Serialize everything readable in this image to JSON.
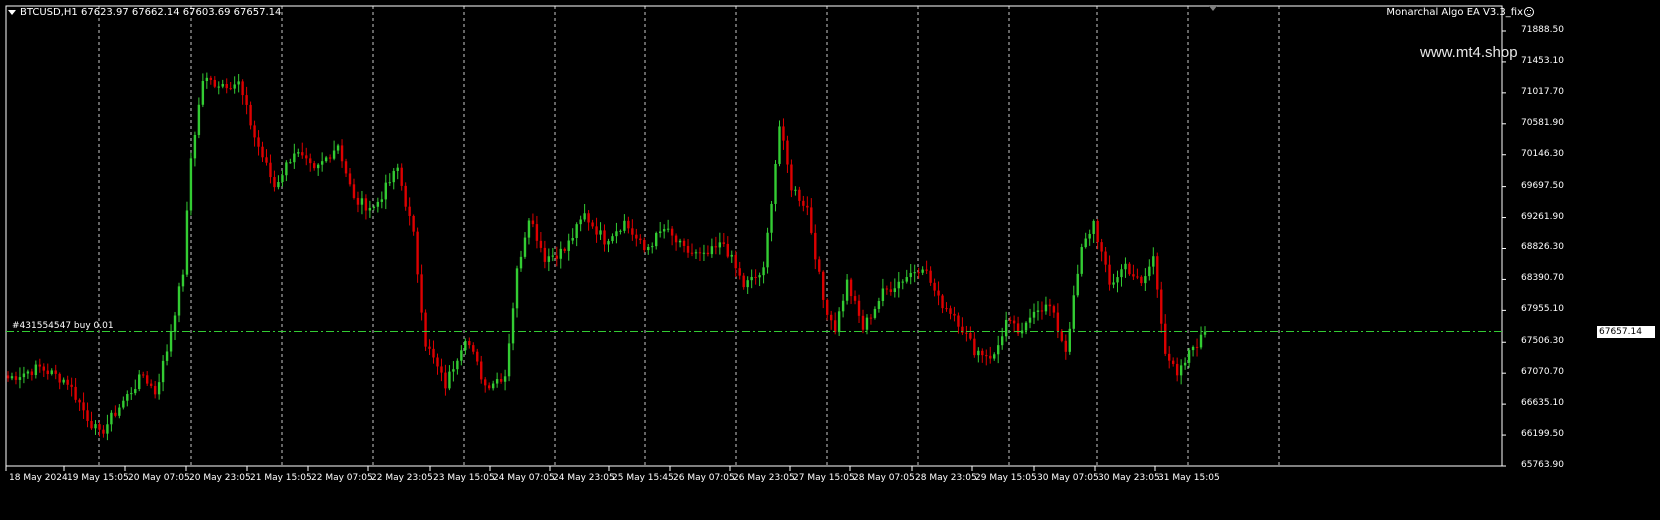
{
  "header": {
    "symbol": "BTCUSD,H1",
    "ohlc": "67623.97 67662.14 67603.69 67657.14",
    "expert_label": "Monarchal Algo EA V3.3_fix",
    "expert_icon": "smiley-icon"
  },
  "watermark": "www.mt4.shop",
  "order_line": {
    "label": "#431554547 buy 0.01",
    "price": 67657.14,
    "color": "#33cc33"
  },
  "current_price_label": "67657.14",
  "colors": {
    "bull": "#33cc33",
    "bear": "#dd0000",
    "grid": "#c8c8c8",
    "background": "#000000",
    "axis": "#ffffff"
  },
  "price_axis": {
    "labels": [
      "71888.50",
      "71453.10",
      "71017.70",
      "70581.90",
      "70146.30",
      "69697.50",
      "69261.90",
      "68826.30",
      "68390.70",
      "67955.10",
      "67506.30",
      "67070.70",
      "66635.10",
      "66199.50",
      "65763.90"
    ],
    "min": 65763.9,
    "max": 71888.5
  },
  "time_axis": {
    "labels": [
      "18 May 2024",
      "19 May 15:05",
      "20 May 07:05",
      "20 May 23:05",
      "21 May 15:05",
      "22 May 07:05",
      "22 May 23:05",
      "23 May 15:05",
      "24 May 07:05",
      "24 May 23:05",
      "25 May 15:45",
      "26 May 07:05",
      "26 May 23:05",
      "27 May 15:05",
      "28 May 07:05",
      "28 May 23:05",
      "29 May 15:05",
      "30 May 07:05",
      "30 May 23:05",
      "31 May 15:05"
    ]
  },
  "chart_data": {
    "type": "candlestick",
    "title": "BTCUSD,H1",
    "xlabel": "",
    "ylabel": "",
    "grid": true,
    "ylim": [
      65763.9,
      71888.5
    ],
    "anchors": [
      [
        0,
        67000
      ],
      [
        8,
        67150
      ],
      [
        15,
        66950
      ],
      [
        20,
        66450
      ],
      [
        23,
        66200
      ],
      [
        28,
        66600
      ],
      [
        34,
        67050
      ],
      [
        37,
        66800
      ],
      [
        40,
        67400
      ],
      [
        44,
        68500
      ],
      [
        46,
        70100
      ],
      [
        49,
        71200
      ],
      [
        53,
        71150
      ],
      [
        58,
        71150
      ],
      [
        62,
        70400
      ],
      [
        67,
        69700
      ],
      [
        72,
        70200
      ],
      [
        77,
        69900
      ],
      [
        83,
        70300
      ],
      [
        87,
        69500
      ],
      [
        92,
        69400
      ],
      [
        98,
        69950
      ],
      [
        102,
        69000
      ],
      [
        105,
        67500
      ],
      [
        110,
        66900
      ],
      [
        115,
        67600
      ],
      [
        120,
        66900
      ],
      [
        125,
        67050
      ],
      [
        128,
        68500
      ],
      [
        131,
        69300
      ],
      [
        135,
        68700
      ],
      [
        140,
        68800
      ],
      [
        145,
        69300
      ],
      [
        150,
        68950
      ],
      [
        155,
        69200
      ],
      [
        160,
        68800
      ],
      [
        165,
        69100
      ],
      [
        170,
        68800
      ],
      [
        175,
        68700
      ],
      [
        180,
        68900
      ],
      [
        185,
        68300
      ],
      [
        190,
        68500
      ],
      [
        194,
        70550
      ],
      [
        197,
        69700
      ],
      [
        201,
        69400
      ],
      [
        205,
        68100
      ],
      [
        208,
        67700
      ],
      [
        211,
        68350
      ],
      [
        215,
        67700
      ],
      [
        220,
        68200
      ],
      [
        225,
        68400
      ],
      [
        230,
        68600
      ],
      [
        234,
        68100
      ],
      [
        238,
        67900
      ],
      [
        243,
        67400
      ],
      [
        248,
        67300
      ],
      [
        251,
        67800
      ],
      [
        255,
        67600
      ],
      [
        258,
        68000
      ],
      [
        262,
        68000
      ],
      [
        266,
        67400
      ],
      [
        270,
        68800
      ],
      [
        273,
        69200
      ],
      [
        277,
        68300
      ],
      [
        281,
        68600
      ],
      [
        285,
        68300
      ],
      [
        288,
        68700
      ],
      [
        291,
        67400
      ],
      [
        294,
        67000
      ],
      [
        298,
        67450
      ],
      [
        301,
        67600
      ]
    ],
    "last_close": 67657.14
  }
}
